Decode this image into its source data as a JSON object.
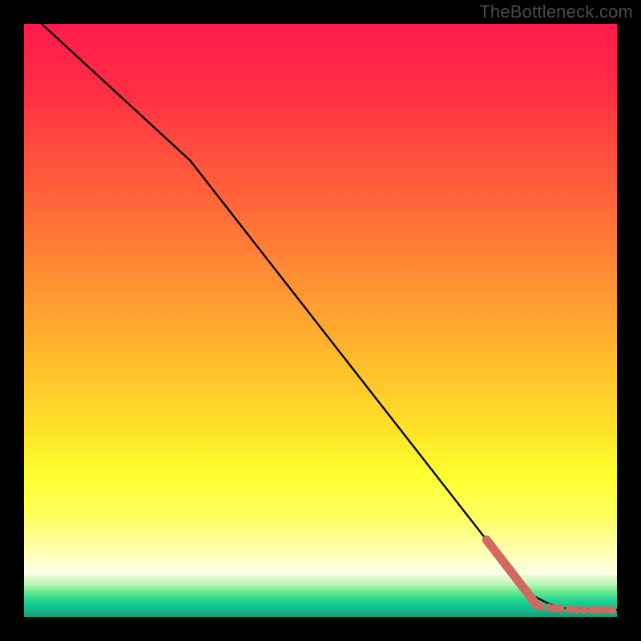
{
  "watermark": "TheBottleneck.com",
  "colors": {
    "background": "#000000",
    "curve": "#000000",
    "marker": "#d06a60",
    "gradient_top": "#ff1a4b",
    "gradient_mid": "#ffff2e",
    "gradient_bottom": "#159c79"
  },
  "chart_data": {
    "type": "line",
    "title": "",
    "xlabel": "",
    "ylabel": "",
    "xlim": [
      0,
      100
    ],
    "ylim": [
      0,
      100
    ],
    "grid": false,
    "curve": [
      {
        "x": 3,
        "y": 100
      },
      {
        "x": 28,
        "y": 77
      },
      {
        "x": 78,
        "y": 13
      },
      {
        "x": 85,
        "y": 4
      },
      {
        "x": 90,
        "y": 1.5
      },
      {
        "x": 100,
        "y": 1.2
      }
    ],
    "marker_segment_start": {
      "x": 78,
      "y": 13
    },
    "marker_segment_end": {
      "x": 86.5,
      "y": 2
    },
    "markers": [
      {
        "x": 87.0,
        "y": 1.8,
        "r": 5
      },
      {
        "x": 88.5,
        "y": 1.6,
        "r": 5
      },
      {
        "x": 89.5,
        "y": 1.5,
        "r": 5
      },
      {
        "x": 90.5,
        "y": 1.4,
        "r": 5
      },
      {
        "x": 92.0,
        "y": 1.3,
        "r": 5
      },
      {
        "x": 93.2,
        "y": 1.25,
        "r": 5
      },
      {
        "x": 94.5,
        "y": 1.2,
        "r": 5
      },
      {
        "x": 95.8,
        "y": 1.2,
        "r": 5
      },
      {
        "x": 97.0,
        "y": 1.2,
        "r": 5
      },
      {
        "x": 98.2,
        "y": 1.2,
        "r": 5
      },
      {
        "x": 99.2,
        "y": 1.2,
        "r": 5
      }
    ]
  }
}
